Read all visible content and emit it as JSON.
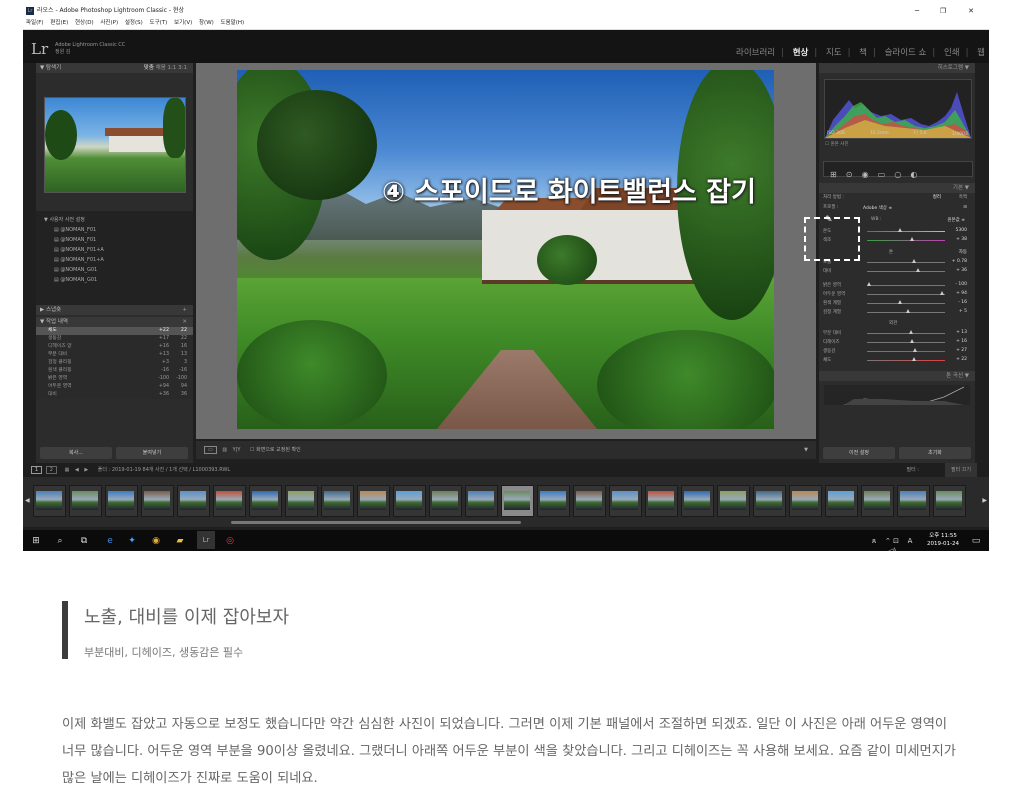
{
  "window": {
    "title": "라오스 - Adobe Photoshop Lightroom Classic - 현상",
    "app_icon": "Lr",
    "minimize": "─",
    "maximize": "❐",
    "close": "✕"
  },
  "menu": [
    "파일(F)",
    "편집(E)",
    "현상(D)",
    "사진(P)",
    "설정(S)",
    "도구(T)",
    "보기(V)",
    "창(W)",
    "도움말(H)"
  ],
  "identity": {
    "logo": "Lr",
    "product": "Adobe Lightroom Classic CC",
    "user": "정원 김",
    "modules": [
      "라이브러리",
      "현상",
      "지도",
      "책",
      "슬라이드 쇼",
      "인쇄",
      "웹"
    ],
    "active_module": "현상"
  },
  "left_panel": {
    "navigator": "탐색기",
    "nav_zoom": [
      "맞춤",
      "채움",
      "1:1",
      "3:1"
    ],
    "user_presets": "사용자 사전 설정",
    "presets": [
      "@NOMAN_F01",
      "@NOMAN_F01",
      "@NOMAN_F01+A",
      "@NOMAN_F01+A",
      "@NOMAN_G01",
      "@NOMAN_G01"
    ],
    "snapshots": "스냅숏",
    "history": "작업 내역",
    "history_rows": [
      {
        "name": "채도",
        "v1": "+22",
        "v2": "22",
        "selected": true
      },
      {
        "name": "생동감",
        "v1": "+17",
        "v2": "22"
      },
      {
        "name": "디헤이즈 양",
        "v1": "+16",
        "v2": "16"
      },
      {
        "name": "부분 대비",
        "v1": "+13",
        "v2": "13"
      },
      {
        "name": "검정 클리핑",
        "v1": "+3",
        "v2": "3"
      },
      {
        "name": "흰색 클리핑",
        "v1": "-16",
        "v2": "-16"
      },
      {
        "name": "밝은 영역",
        "v1": "-100",
        "v2": "-100"
      },
      {
        "name": "어두운 영역",
        "v1": "+94",
        "v2": "94"
      },
      {
        "name": "대비",
        "v1": "+36",
        "v2": "36"
      }
    ],
    "copy_button": "복사...",
    "paste_button": "붙여넣기"
  },
  "photo": {
    "overlay_text": "④ 스포이드로 화이트밸런스 잡기",
    "toolbar_label": "화면으로 교정된 확인"
  },
  "right_panel": {
    "histogram": "히스토그램",
    "exif": [
      "ISO 200",
      "10.5mm",
      "f / 5.6",
      "1/400초"
    ],
    "original_photo": "원본 사진",
    "basic": "기본",
    "treatment_label": "처리 방법 :",
    "color": "컬러",
    "bw": "흑백",
    "profile_label": "프로필 :",
    "profile": "Adobe 색상 ≑",
    "wb_label": "WB :",
    "wb_value": "원본값 ≑",
    "sliders": [
      {
        "label": "온도",
        "value": "5300",
        "pos": 0.42
      },
      {
        "label": "색조",
        "value": "+ 38",
        "pos": 0.58
      },
      {
        "label": "노출",
        "value": "+ 0.78",
        "pos": 0.6
      },
      {
        "label": "대비",
        "value": "+ 36",
        "pos": 0.66
      },
      {
        "label": "밝은 영역",
        "value": "- 100",
        "pos": 0.02
      },
      {
        "label": "어두운 영역",
        "value": "+ 94",
        "pos": 0.96
      },
      {
        "label": "흰색 계열",
        "value": "- 16",
        "pos": 0.42
      },
      {
        "label": "검정 계열",
        "value": "+ 5",
        "pos": 0.52
      },
      {
        "label": "부분 대비",
        "value": "+ 13",
        "pos": 0.56
      },
      {
        "label": "디헤이즈",
        "value": "+ 16",
        "pos": 0.58
      },
      {
        "label": "생동감",
        "value": "+ 27",
        "pos": 0.62
      },
      {
        "label": "채도",
        "value": "+ 22",
        "pos": 0.6
      }
    ],
    "tone_label": "톤",
    "auto_label": "자동",
    "presence_label": "외관",
    "tone_curve": "톤 곡선",
    "prev_button": "이전 설정",
    "reset_button": "초기화"
  },
  "filmstrip": {
    "info": "폴더 : 2019-01-19   84개 사진 / 1개 선택 / L1000393.RWL",
    "filter_label": "필터 :",
    "filter_value": "필터 끄기"
  },
  "taskbar": {
    "time": "오후 11:55",
    "date": "2019-01-24",
    "ime": "A"
  },
  "article": {
    "heading": "노출, 대비를 이제 잡아보자",
    "subheading": "부분대비, 디헤이즈, 생동감은 필수",
    "body": "이제 화밸도 잡았고 자동으로 보정도 했습니다만 약간 심심한 사진이 되었습니다. 그러면 이제 기본 패널에서 조절하면 되겠죠. 일단 이 사진은 아래 어두운 영역이 너무 많습니다. 어두운 영역 부분을 90이상 올렸네요. 그랬더니 아래쪽 어두운 부분이 색을 찾았습니다. 그리고 디헤이즈는 꼭 사용해 보세요. 요즘 같이 미세먼지가 많은 날에는 디헤이즈가 진짜로 도움이 되네요."
  }
}
